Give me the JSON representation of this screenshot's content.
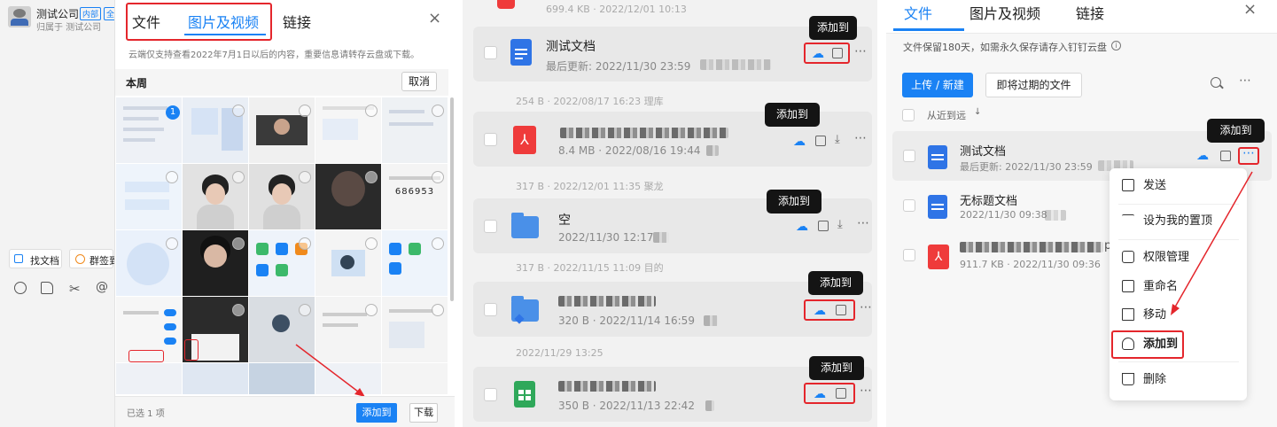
{
  "left": {
    "chat": {
      "name": "测试公司",
      "tag1": "内部",
      "tag2": "全",
      "sub": "归属于 测试公司",
      "find_doc": "找文档",
      "group_sign": "群签到"
    },
    "tabs": [
      "文件",
      "图片及视频",
      "链接"
    ],
    "notice": "云端仅支持查看2022年7月1日以后的内容，重要信息请转存云盘或下载。",
    "section": "本周",
    "cancel": "取消",
    "badge": "1",
    "code": "686953",
    "selected": "已选 1 项",
    "add_to": "添加到",
    "download": "下载"
  },
  "middle": {
    "tooltip": "添加到",
    "top_meta": "699.4 KB · 2022/12/01 10:13",
    "files": [
      {
        "name": "测试文档",
        "meta": "最后更新: 2022/11/30 23:59",
        "sub": "254 B · 2022/08/17 16:23 理库"
      },
      {
        "name": "",
        "meta": "8.4 MB · 2022/08/16 19:44",
        "sub": "317 B · 2022/12/01 11:35 聚龙"
      },
      {
        "name": "空",
        "meta": "2022/11/30 12:17",
        "sub": "317 B · 2022/11/15 11:09 目的"
      },
      {
        "name": "",
        "meta": "320 B · 2022/11/14 16:59",
        "sub": "2022/11/29 13:25"
      },
      {
        "name": "",
        "meta": "350 B · 2022/11/13 22:42"
      }
    ]
  },
  "right": {
    "tabs": [
      "文件",
      "图片及视频",
      "链接"
    ],
    "notice": "文件保留180天，如需永久保存请存入钉钉云盘",
    "upload": "上传 / 新建",
    "expiring": "即将过期的文件",
    "sort": "从近到远",
    "tooltip": "添加到",
    "files": [
      {
        "name": "测试文档",
        "meta": "最后更新: 2022/11/30 23:59"
      },
      {
        "name": "无标题文档",
        "meta": "2022/11/30 09:38"
      },
      {
        "name": "pc",
        "meta": "911.7 KB · 2022/11/30 09:36"
      }
    ],
    "menu": [
      "发送",
      "设为我的置顶",
      "权限管理",
      "重命名",
      "移动",
      "添加到",
      "删除"
    ]
  },
  "colors": {
    "accent": "#1a82f4",
    "red": "#e4262c",
    "pdf": "#ef3b3b",
    "folder": "#4a90e8"
  }
}
